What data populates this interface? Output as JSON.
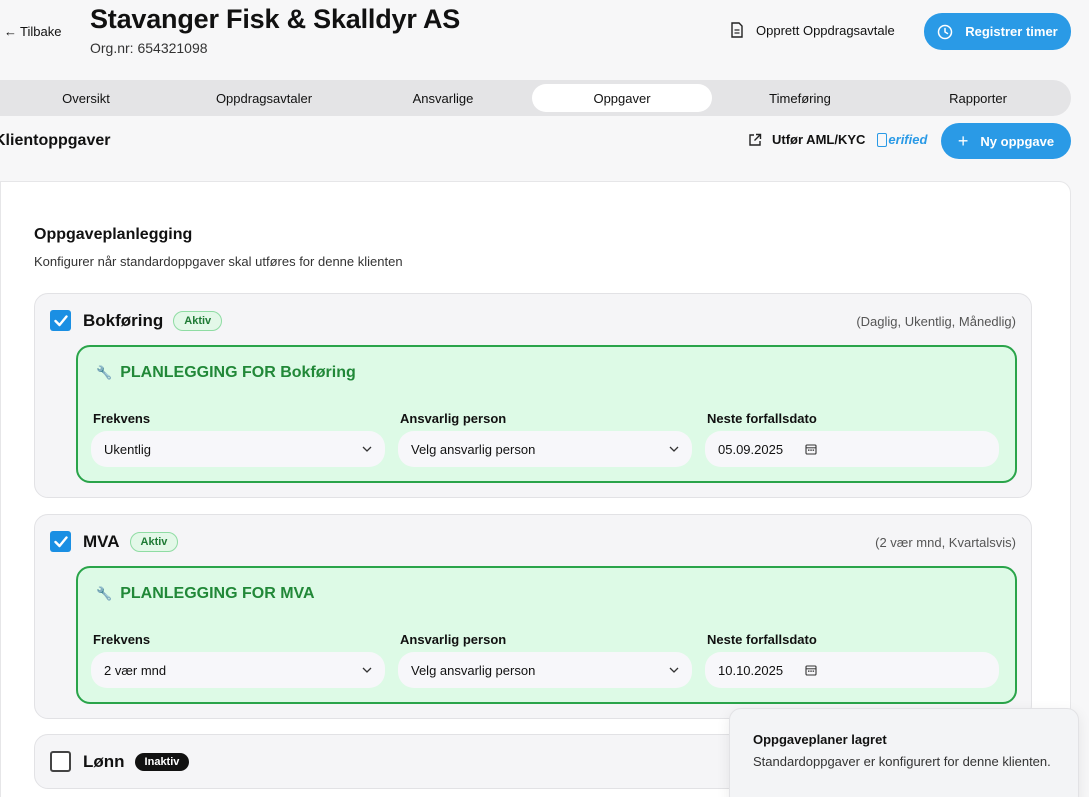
{
  "header": {
    "back_label": "Tilbake",
    "client_name": "Stavanger Fisk & Skalldyr AS",
    "org_nr": "Org.nr: 654321098",
    "create_agreement_label": "Opprett Oppdragsavtale",
    "register_hours_label": "Registrer timer"
  },
  "tabs": [
    {
      "label": "Oversikt"
    },
    {
      "label": "Oppdragsavtaler"
    },
    {
      "label": "Ansvarlige"
    },
    {
      "label": "Oppgaver",
      "active": true
    },
    {
      "label": "Timeføring"
    },
    {
      "label": "Rapporter"
    }
  ],
  "section": {
    "title": "Klientoppgaver",
    "aml_label": "Utfør AML/KYC",
    "verified_label": "erified",
    "new_task_label": "Ny oppgave"
  },
  "planning": {
    "title": "Oppgaveplanlegging",
    "subtitle": "Konfigurer når standardoppgaver skal utføres for denne klienten"
  },
  "tasks": [
    {
      "name": "Bokføring",
      "badge": "Aktiv",
      "frequencies": "(Daglig, Ukentlig, Månedlig)",
      "checked": true,
      "plan_title": "PLANLEGGING FOR Bokføring",
      "frequency_label": "Frekvens",
      "frequency_value": "Ukentlig",
      "responsible_label": "Ansvarlig person",
      "responsible_value": "Velg ansvarlig person",
      "due_label": "Neste forfallsdato",
      "due_value": "05.09.2025"
    },
    {
      "name": "MVA",
      "badge": "Aktiv",
      "frequencies": "(2 vær mnd, Kvartalsvis)",
      "checked": true,
      "plan_title": "PLANLEGGING FOR MVA",
      "frequency_label": "Frekvens",
      "frequency_value": "2 vær mnd",
      "responsible_label": "Ansvarlig person",
      "responsible_value": "Velg ansvarlig person",
      "due_label": "Neste forfallsdato",
      "due_value": "10.10.2025"
    },
    {
      "name": "Lønn",
      "badge": "Inaktiv",
      "checked": false
    }
  ],
  "toast": {
    "title": "Oppgaveplaner lagret",
    "text": "Standardoppgaver er konfigurert for denne klienten."
  },
  "colors": {
    "primary": "#2a9ae6",
    "plan_bg": "#ddfae6",
    "plan_border": "#2aa44a",
    "plan_title": "#218838"
  },
  "icons": [
    "arrow-left-icon",
    "document-icon",
    "clock-icon",
    "external-link-icon",
    "plus-icon",
    "checkmark-icon",
    "wrench-icon",
    "chevron-down-icon",
    "calendar-icon"
  ]
}
